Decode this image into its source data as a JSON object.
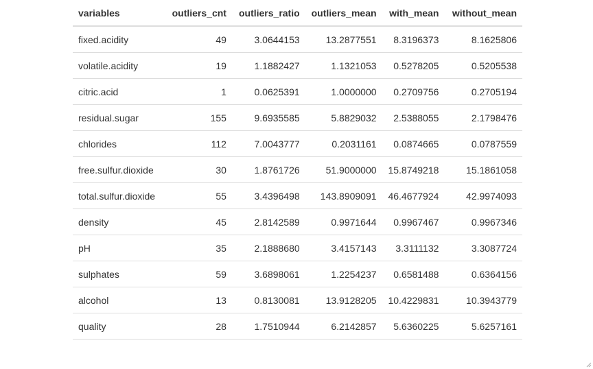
{
  "table": {
    "columns": [
      "variables",
      "outliers_cnt",
      "outliers_ratio",
      "outliers_mean",
      "with_mean",
      "without_mean"
    ],
    "rows": [
      [
        "fixed.acidity",
        "49",
        "3.0644153",
        "13.2877551",
        "8.3196373",
        "8.1625806"
      ],
      [
        "volatile.acidity",
        "19",
        "1.1882427",
        "1.1321053",
        "0.5278205",
        "0.5205538"
      ],
      [
        "citric.acid",
        "1",
        "0.0625391",
        "1.0000000",
        "0.2709756",
        "0.2705194"
      ],
      [
        "residual.sugar",
        "155",
        "9.6935585",
        "5.8829032",
        "2.5388055",
        "2.1798476"
      ],
      [
        "chlorides",
        "112",
        "7.0043777",
        "0.2031161",
        "0.0874665",
        "0.0787559"
      ],
      [
        "free.sulfur.dioxide",
        "30",
        "1.8761726",
        "51.9000000",
        "15.8749218",
        "15.1861058"
      ],
      [
        "total.sulfur.dioxide",
        "55",
        "3.4396498",
        "143.8909091",
        "46.4677924",
        "42.9974093"
      ],
      [
        "density",
        "45",
        "2.8142589",
        "0.9971644",
        "0.9967467",
        "0.9967346"
      ],
      [
        "pH",
        "35",
        "2.1888680",
        "3.4157143",
        "3.3111132",
        "3.3087724"
      ],
      [
        "sulphates",
        "59",
        "3.6898061",
        "1.2254237",
        "0.6581488",
        "0.6364156"
      ],
      [
        "alcohol",
        "13",
        "0.8130081",
        "13.9128205",
        "10.4229831",
        "10.3943779"
      ],
      [
        "quality",
        "28",
        "1.7510944",
        "6.2142857",
        "5.6360225",
        "5.6257161"
      ]
    ]
  },
  "icons": {
    "resize": "resize-grip-icon"
  }
}
